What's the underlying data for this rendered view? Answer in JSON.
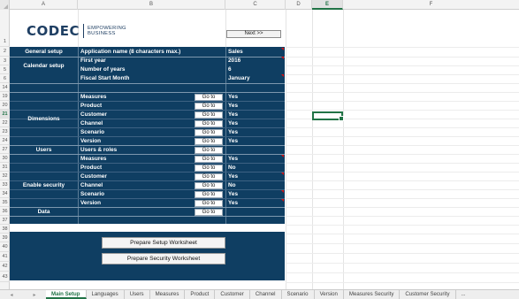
{
  "columns": [
    "A",
    "B",
    "C",
    "D",
    "E",
    "F"
  ],
  "rows": [
    "1",
    "2",
    "3",
    "5",
    "6",
    "14",
    "19",
    "20",
    "21",
    "22",
    "23",
    "24",
    "27",
    "30",
    "31",
    "32",
    "33",
    "34",
    "35",
    "36",
    "37",
    "38",
    "39",
    "40",
    "41",
    "42",
    "43"
  ],
  "active_row": "21",
  "active_column": "E",
  "logo": {
    "name": "CODEC",
    "tag_line1": "EMPOWERING",
    "tag_line2": "BUSINESS"
  },
  "next_button": "Next >>",
  "general_setup": {
    "label": "General setup",
    "app_name_label": "Application name (8 characters max.)",
    "app_name_value": "Sales"
  },
  "calendar_setup": {
    "label": "Calendar setup",
    "items": [
      {
        "label": "First year",
        "value": "2016"
      },
      {
        "label": "Number of years",
        "value": "6"
      },
      {
        "label": "Fiscal Start Month",
        "value": "January"
      }
    ]
  },
  "dimensions": {
    "label": "Dimensions",
    "items": [
      {
        "label": "Measures",
        "goto": "Go to",
        "value": "Yes"
      },
      {
        "label": "Product",
        "goto": "Go to",
        "value": "Yes"
      },
      {
        "label": "Customer",
        "goto": "Go to",
        "value": "Yes"
      },
      {
        "label": "Channel",
        "goto": "Go to",
        "value": "Yes"
      },
      {
        "label": "Scenario",
        "goto": "Go to",
        "value": "Yes"
      },
      {
        "label": "Version",
        "goto": "Go to",
        "value": "Yes"
      }
    ]
  },
  "users": {
    "label": "Users",
    "item_label": "Users & roles",
    "goto": "Go to"
  },
  "enable_security": {
    "label": "Enable security",
    "items": [
      {
        "label": "Measures",
        "goto": "Go to",
        "value": "Yes"
      },
      {
        "label": "Product",
        "goto": "Go to",
        "value": "No"
      },
      {
        "label": "Customer",
        "goto": "Go to",
        "value": "Yes"
      },
      {
        "label": "Channel",
        "goto": "Go to",
        "value": "No"
      },
      {
        "label": "Scenario",
        "goto": "Go to",
        "value": "Yes"
      },
      {
        "label": "Version",
        "goto": "Go to",
        "value": "Yes"
      }
    ]
  },
  "data_row": {
    "label": "Data",
    "goto": "Go to"
  },
  "buttons": {
    "prepare_setup": "Prepare Setup Worksheet",
    "prepare_security": "Prepare Security Worksheet"
  },
  "tabs": [
    "Main Setup",
    "Languages",
    "Users",
    "Measures",
    "Product",
    "Customer",
    "Channel",
    "Scenario",
    "Version",
    "Measures Security",
    "Customer Security"
  ],
  "tab_nav": {
    "left": "◂",
    "right": "▸",
    "more": "..."
  },
  "colors": {
    "panel": "#0f3e62",
    "excel_green": "#217346"
  }
}
